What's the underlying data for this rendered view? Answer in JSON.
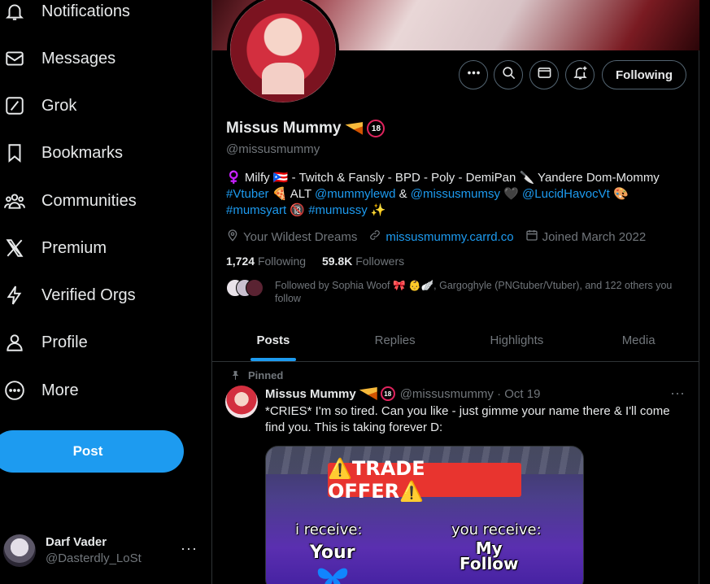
{
  "nav": {
    "items": [
      {
        "label": "Notifications",
        "icon": "bell-icon"
      },
      {
        "label": "Messages",
        "icon": "envelope-icon"
      },
      {
        "label": "Grok",
        "icon": "grok-icon"
      },
      {
        "label": "Bookmarks",
        "icon": "bookmark-icon"
      },
      {
        "label": "Communities",
        "icon": "communities-icon"
      },
      {
        "label": "Premium",
        "icon": "x-logo-icon"
      },
      {
        "label": "Verified Orgs",
        "icon": "lightning-icon"
      },
      {
        "label": "Profile",
        "icon": "person-icon"
      },
      {
        "label": "More",
        "icon": "more-circle-icon"
      }
    ],
    "post_label": "Post"
  },
  "account": {
    "display_name": "Darf Vader",
    "username": "@Dasterdly_LoSt",
    "more": "···"
  },
  "profile": {
    "display_name": "Missus Mummy",
    "handle": "@missusmummy",
    "following_label": "Following",
    "bio": {
      "part1": "♀️ Milfy 🇵🇷 - Twitch & Fansly - BPD - Poly - DemiPan 🔪 Yandere Dom-Mommy",
      "tag_vtuber": "#Vtuber",
      "part2": " 🍕 ALT ",
      "mention1": "@mummylewd",
      "amp": " & ",
      "mention2": "@missusmumsy",
      "part3": " 🖤 ",
      "mention3": "@LucidHavocVt",
      "part4": " 🎨",
      "tag_art": "#mumsyart",
      "part5": " 🔞 ",
      "tag_mumussy": "#mumussy",
      "part6": " ✨"
    },
    "location": "Your Wildest Dreams",
    "website": "missusmummy.carrd.co",
    "joined": "Joined March 2022",
    "following_count": "1,724",
    "following_text": "Following",
    "followers_count": "59.8K",
    "followers_text": "Followers",
    "followed_by": "Followed by Sophia Woof 🎀 👶🪽, Gargoghyle (PNGtuber/Vtuber), and 122 others you follow"
  },
  "tabs": [
    {
      "label": "Posts",
      "active": true
    },
    {
      "label": "Replies",
      "active": false
    },
    {
      "label": "Highlights",
      "active": false
    },
    {
      "label": "Media",
      "active": false
    }
  ],
  "post": {
    "pinned_label": "Pinned",
    "author": "Missus Mummy",
    "handle_date": "@missusmummy · Oct 19",
    "more": "···",
    "text": "*CRIES* I'm so tired. Can you like - just gimme your name there & I'll come find you. This is taking forever D:",
    "media": {
      "banner": "⚠️TRADE OFFER⚠️",
      "left_label": "i receive:",
      "left_value": "Your",
      "right_label": "you receive:",
      "right_value_1": "My",
      "right_value_2": "Follow"
    }
  },
  "colors": {
    "accent": "#1d9bf0",
    "background": "#000000",
    "text": "#e7e9ea",
    "muted": "#71767b",
    "border": "#2f3336"
  }
}
